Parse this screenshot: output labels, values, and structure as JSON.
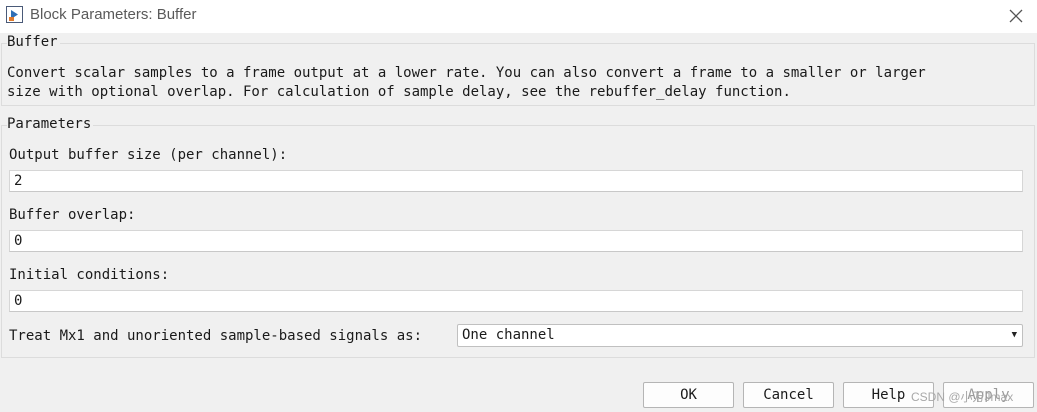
{
  "window": {
    "title": "Block Parameters: Buffer"
  },
  "block": {
    "name": "Buffer",
    "description": "Convert scalar samples to a frame output at a lower rate. You can also convert a frame to a smaller or larger\nsize with optional overlap. For calculation of sample delay, see the rebuffer_delay function."
  },
  "parameters": {
    "title": "Parameters",
    "output_buffer_size": {
      "label": "Output buffer size (per channel):",
      "value": "2"
    },
    "buffer_overlap": {
      "label": "Buffer overlap:",
      "value": "0"
    },
    "initial_conditions": {
      "label": "Initial conditions:",
      "value": "0"
    },
    "treat_signals": {
      "label": "Treat Mx1 and unoriented sample-based signals as:",
      "selected": "One channel"
    }
  },
  "buttons": {
    "ok": "OK",
    "cancel": "Cancel",
    "help": "Help",
    "apply": "Apply"
  },
  "watermark": "CSDN @小万Jmax",
  "icons": {
    "app": "simulink-block-icon",
    "close": "close-icon",
    "dropdown": "chevron-down-icon"
  }
}
